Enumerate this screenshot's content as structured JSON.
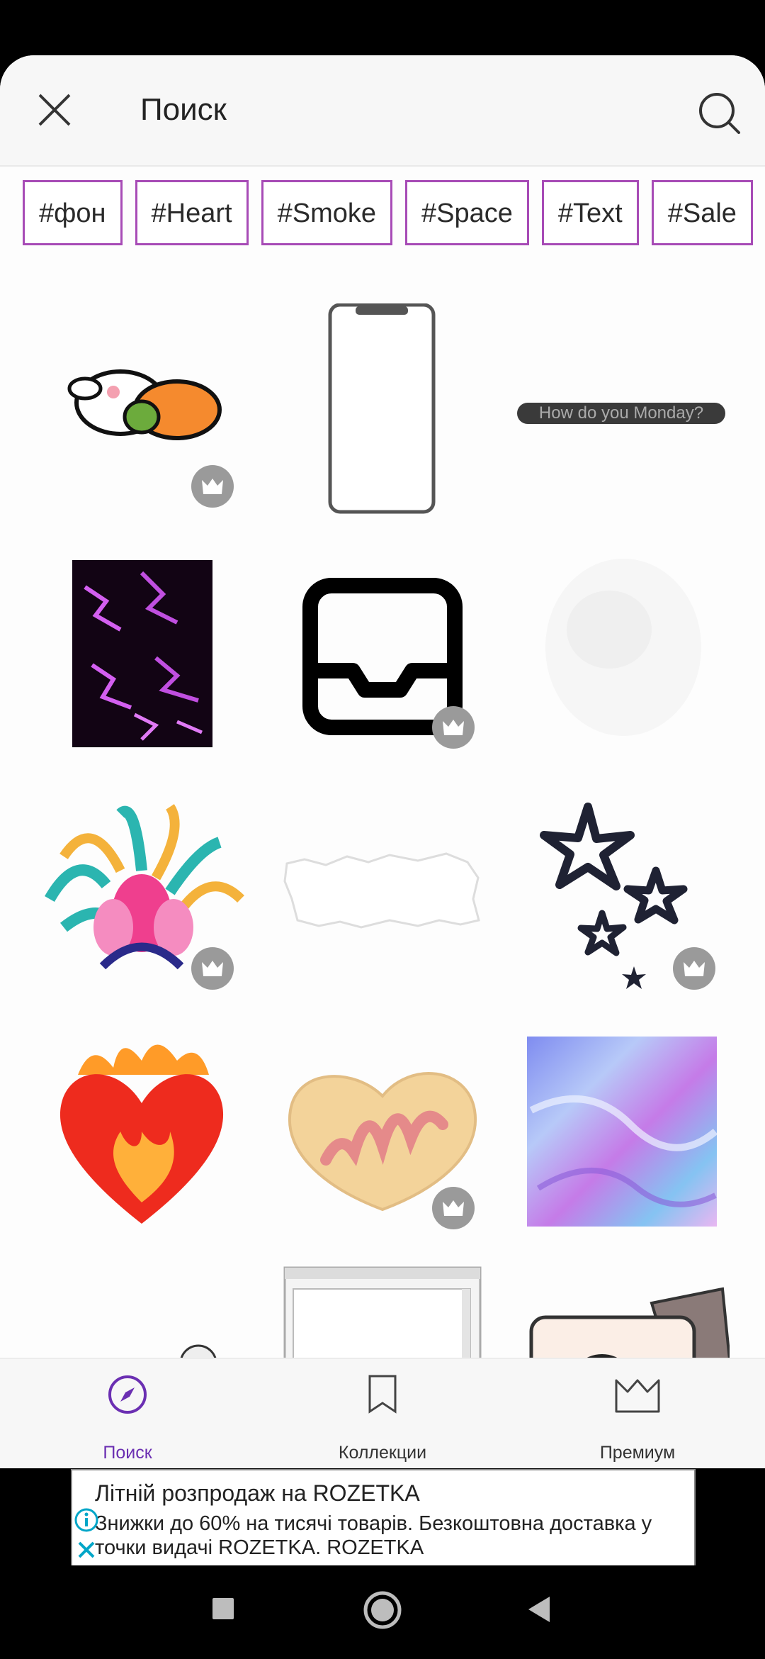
{
  "header": {
    "title": "Поиск"
  },
  "tags": [
    "#фон",
    "#Heart",
    "#Smoke",
    "#Space",
    "#Text",
    "#Sale"
  ],
  "stickers": {
    "monday_text": "How do you Monday?"
  },
  "bottom_nav": {
    "items": [
      {
        "label": "Поиск",
        "active": true
      },
      {
        "label": "Коллекции",
        "active": false
      },
      {
        "label": "Премиум",
        "active": false
      }
    ]
  },
  "ad": {
    "title": "Літній розпродаж на ROZETKA",
    "body": "Знижки до 60% на тисячі товарів. Безкоштовна доставка у точки видачі ROZETKA. ROZETKA"
  },
  "colors": {
    "accent": "#6b2fb2",
    "tag_border": "#a74bb6"
  }
}
